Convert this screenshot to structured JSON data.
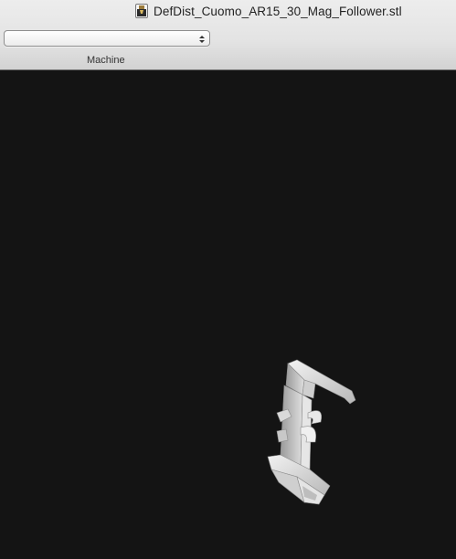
{
  "window": {
    "title": "DefDist_Cuomo_AR15_30_Mag_Follower.stl",
    "document_icon": "stl-document-icon"
  },
  "toolbar": {
    "machine_select": {
      "value": "",
      "icon": "select-arrows-icon"
    },
    "machine_label": "Machine"
  },
  "viewport": {
    "background": "#141414",
    "model_name": "DefDist_Cuomo_AR15_30_Mag_Follower",
    "model_color": "#dcdcdc"
  }
}
